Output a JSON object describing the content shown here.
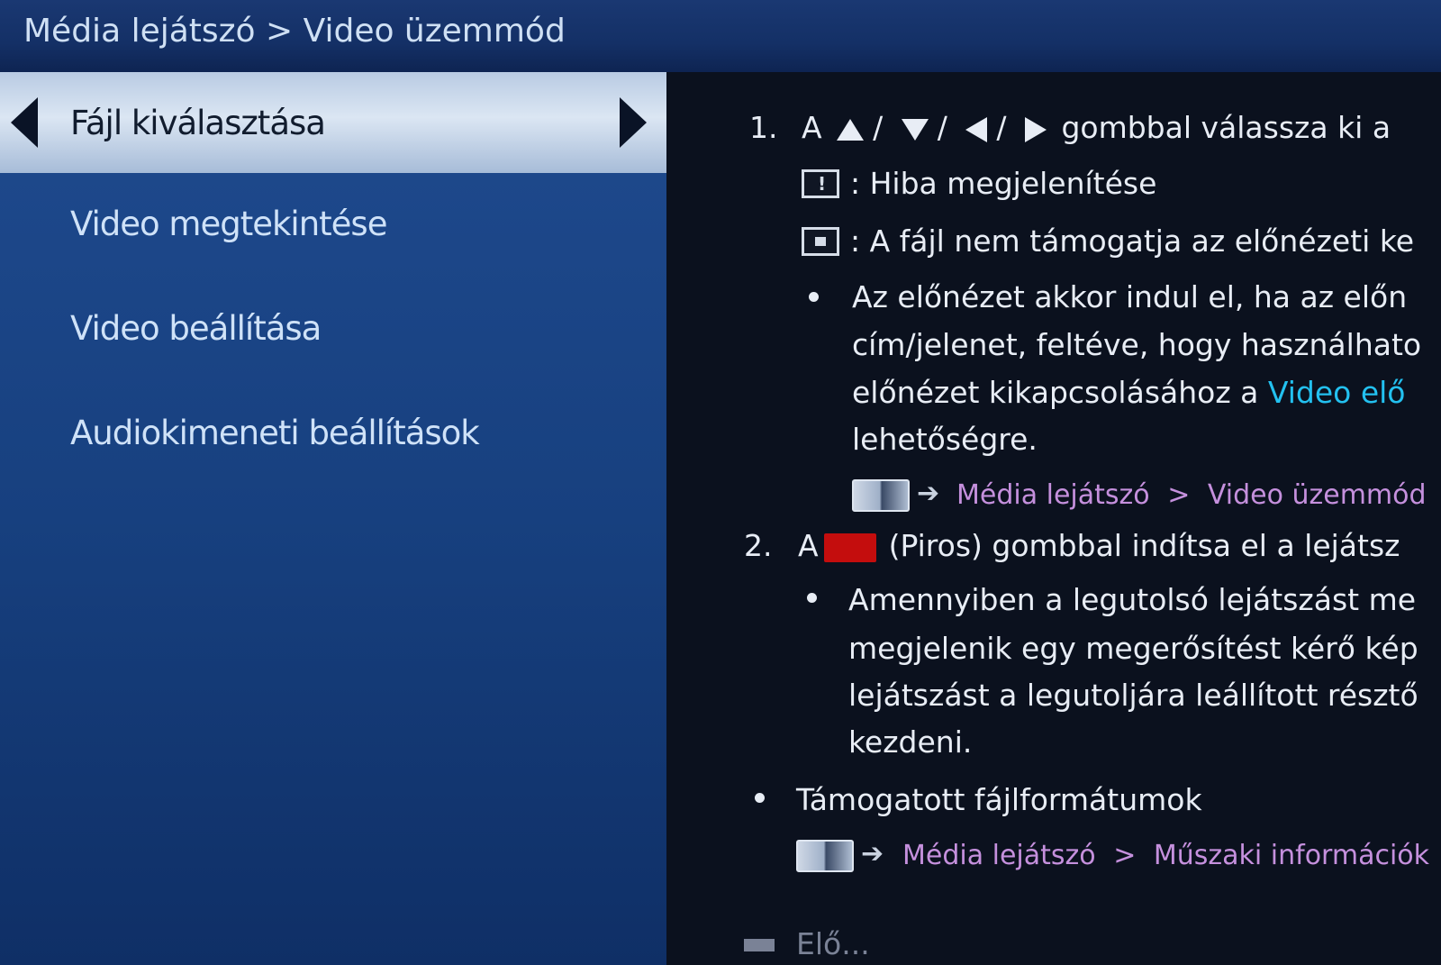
{
  "header": {
    "breadcrumb": "Média lejátszó > Video üzemmód"
  },
  "sidebar": {
    "items": [
      {
        "label": "Fájl kiválasztása",
        "active": true
      },
      {
        "label": "Video megtekintése",
        "active": false
      },
      {
        "label": "Video beállítása",
        "active": false
      },
      {
        "label": "Audiokimeneti beállítások",
        "active": false
      }
    ]
  },
  "content": {
    "step1": {
      "number": "1.",
      "prefix": "A",
      "slash": "/",
      "suffix": "gombbal válassza ki a",
      "icon_error_text": ": Hiba megjelenítése",
      "icon_unsupported_text": ": A fájl nem támogatja az előnézeti ke",
      "bullet_lines": [
        "Az előnézet akkor indul el, ha az előn",
        "cím/jelenet, feltéve, hogy használhato"
      ],
      "bullet_line3_prefix": "előnézet kikapcsolásához a ",
      "bullet_line3_link": "Video elő",
      "bullet_line4": "lehetőségre.",
      "ref_part1": "Média lejátszó",
      "ref_sep": ">",
      "ref_part2": "Video üzemmód"
    },
    "step2": {
      "number": "2.",
      "prefix": "A",
      "suffix": "(Piros) gombbal indítsa el a lejátsz",
      "bullet_lines": [
        "Amennyiben a legutolsó lejátszást me",
        "megjelenik egy megerősítést kérő kép",
        "lejátszást a legutoljára leállított résztő",
        "kezdeni."
      ]
    },
    "formats": {
      "label": "Támogatott fájlformátumok",
      "ref_part1": "Média lejátszó",
      "ref_sep": ">",
      "ref_part2": "Műszaki információk"
    },
    "cut_off_text": "Elő..."
  },
  "colors": {
    "header_bg": "#143066",
    "sidebar_bg": "#17407f",
    "active_item_bg": "#dbe6f3",
    "content_bg": "#0b111e",
    "link_cyan": "#23c1f0",
    "ref_purple": "#c590dd",
    "red_button": "#c40d0d"
  },
  "icons": [
    "left-arrow-icon",
    "right-arrow-icon",
    "up-triangle-icon",
    "down-triangle-icon",
    "error-icon",
    "unsupported-preview-icon",
    "manual-book-icon",
    "red-button-icon"
  ]
}
